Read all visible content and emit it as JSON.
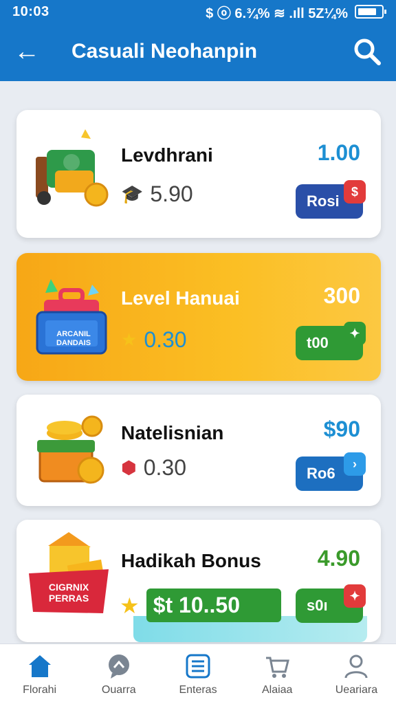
{
  "status_bar": {
    "time": "10:03",
    "indicators": "$ ⓞ 6.¾% ≋ .ıll 5Z¼%"
  },
  "header": {
    "title": "Casuali Neohanpin"
  },
  "cards": [
    {
      "name": "Levdhrani",
      "secondary": "5.90",
      "price": "1.00",
      "button": "Rosi",
      "button_tag": "$",
      "price_color": "#1d8fd3"
    },
    {
      "name": "Level Hanuai",
      "secondary": "0.30",
      "price": "300",
      "button": "t00",
      "button_tag": "✦",
      "price_color": "#ffffff",
      "art_text": "ARCANIL DANDAIS"
    },
    {
      "name": "Natelisnian",
      "secondary": "0.30",
      "price": "$90",
      "button": "Ro6",
      "button_tag": "›",
      "price_color": "#1d8fd3"
    },
    {
      "name": "Hadikah Bonus",
      "secondary": "$t 10..50",
      "price": "4.90",
      "button": "ѕ0ı",
      "button_tag": "✦",
      "price_color": "#3a9a2a",
      "art_text": "CIGRNIX PERRAS"
    }
  ],
  "bottom_nav": [
    {
      "label": "Florahi",
      "icon": "home-icon"
    },
    {
      "label": "Ouarra",
      "icon": "chat-icon"
    },
    {
      "label": "Enteras",
      "icon": "list-icon"
    },
    {
      "label": "Alaiaa",
      "icon": "cart-icon"
    },
    {
      "label": "Ueariara",
      "icon": "profile-icon"
    }
  ],
  "colors": {
    "primary": "#1677c9",
    "featured": "#f7a716",
    "button_blue": "#2a4fa8",
    "button_green": "#2f9a35"
  }
}
